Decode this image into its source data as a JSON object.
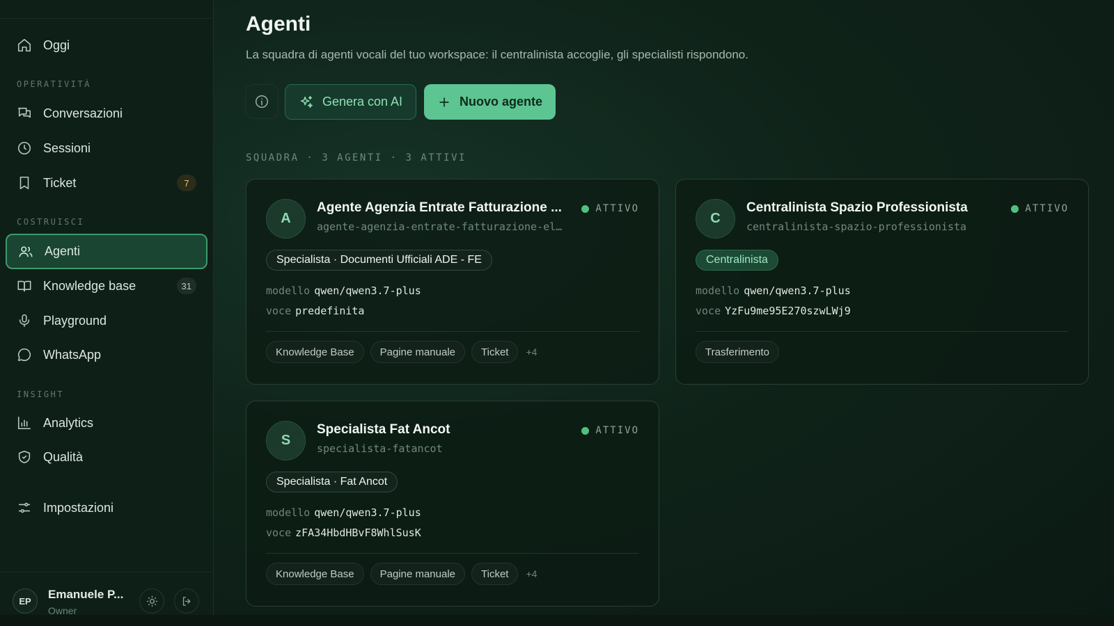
{
  "sidebar": {
    "top_item": "Oggi",
    "sections": [
      {
        "label": "OPERATIVITÀ",
        "items": [
          {
            "label": "Conversazioni",
            "badge": ""
          },
          {
            "label": "Sessioni",
            "badge": ""
          },
          {
            "label": "Ticket",
            "badge": "7"
          }
        ]
      },
      {
        "label": "COSTRUISCI",
        "items": [
          {
            "label": "Agenti",
            "badge": ""
          },
          {
            "label": "Knowledge base",
            "badge": "31"
          },
          {
            "label": "Playground",
            "badge": ""
          },
          {
            "label": "WhatsApp",
            "badge": ""
          }
        ]
      },
      {
        "label": "INSIGHT",
        "items": [
          {
            "label": "Analytics",
            "badge": ""
          },
          {
            "label": "Qualità",
            "badge": ""
          }
        ]
      }
    ],
    "settings": "Impostazioni",
    "user": {
      "initials": "EP",
      "name": "Emanuele P...",
      "role": "Owner"
    }
  },
  "main": {
    "title": "Agenti",
    "subtitle": "La squadra di agenti vocali del tuo workspace: il centralinista accoglie, gli specialisti rispondono.",
    "generate_label": "Genera con AI",
    "new_label": "Nuovo agente",
    "squad_label": "SQUADRA · 3 AGENTI · 3 ATTIVI"
  },
  "agents": [
    {
      "initial": "A",
      "name": "Agente Agenzia Entrate Fatturazione ...",
      "slug": "agente-agenzia-entrate-fatturazione-el…",
      "status": "ATTIVO",
      "role": "Specialista · Documenti Ufficiali ADE - FE",
      "model_key": "modello",
      "model": "qwen/qwen3.7-plus",
      "voice_key": "voce",
      "voice": "predefinita",
      "tags": [
        "Knowledge Base",
        "Pagine manuale",
        "Ticket"
      ],
      "more": "+4"
    },
    {
      "initial": "C",
      "name": "Centralinista Spazio Professionista",
      "slug": "centralinista-spazio-professionista",
      "status": "ATTIVO",
      "role": "Centralinista",
      "model_key": "modello",
      "model": "qwen/qwen3.7-plus",
      "voice_key": "voce",
      "voice": "YzFu9me95E270szwLWj9",
      "tags": [
        "Trasferimento"
      ],
      "more": ""
    },
    {
      "initial": "S",
      "name": "Specialista Fat Ancot",
      "slug": "specialista-fatancot",
      "status": "ATTIVO",
      "role": "Specialista · Fat Ancot",
      "model_key": "modello",
      "model": "qwen/qwen3.7-plus",
      "voice_key": "voce",
      "voice": "zFA34HbdHBvF8WhlSusK",
      "tags": [
        "Knowledge Base",
        "Pagine manuale",
        "Ticket"
      ],
      "more": "+4"
    }
  ],
  "colors": {
    "accent": "#5dc591",
    "active_dot": "#4fc07f",
    "ticket_badge": "#e2c760"
  }
}
